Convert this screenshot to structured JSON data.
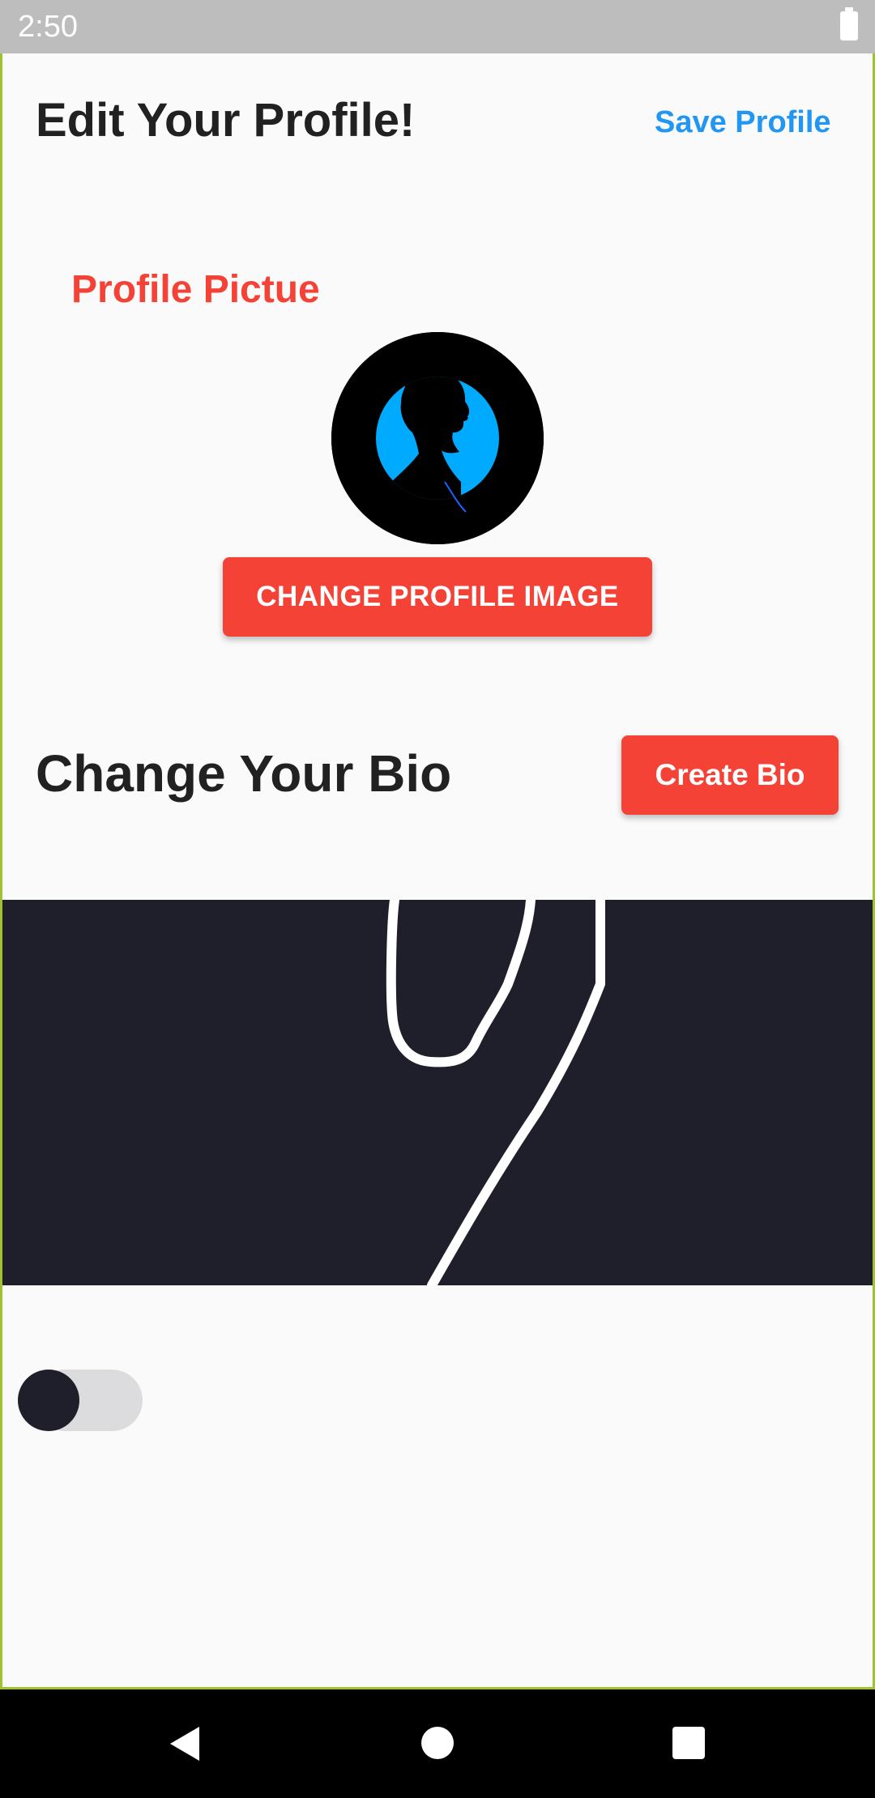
{
  "status_bar": {
    "time": "2:50"
  },
  "header": {
    "title": "Edit Your Profile!",
    "save_label": "Save Profile"
  },
  "profile_picture": {
    "label": "Profile Pictue",
    "change_button_label": "CHANGE PROFILE IMAGE"
  },
  "bio": {
    "title": "Change Your Bio",
    "create_button_label": "Create Bio"
  },
  "toggle": {
    "state": "off"
  },
  "colors": {
    "accent": "#f44336",
    "link": "#2196f3",
    "canvas": "#1f1f2b",
    "avatar_ring": "#00aaff"
  },
  "icons": {
    "battery": "battery-icon",
    "back": "back-icon",
    "home": "home-icon",
    "recents": "recents-icon"
  }
}
